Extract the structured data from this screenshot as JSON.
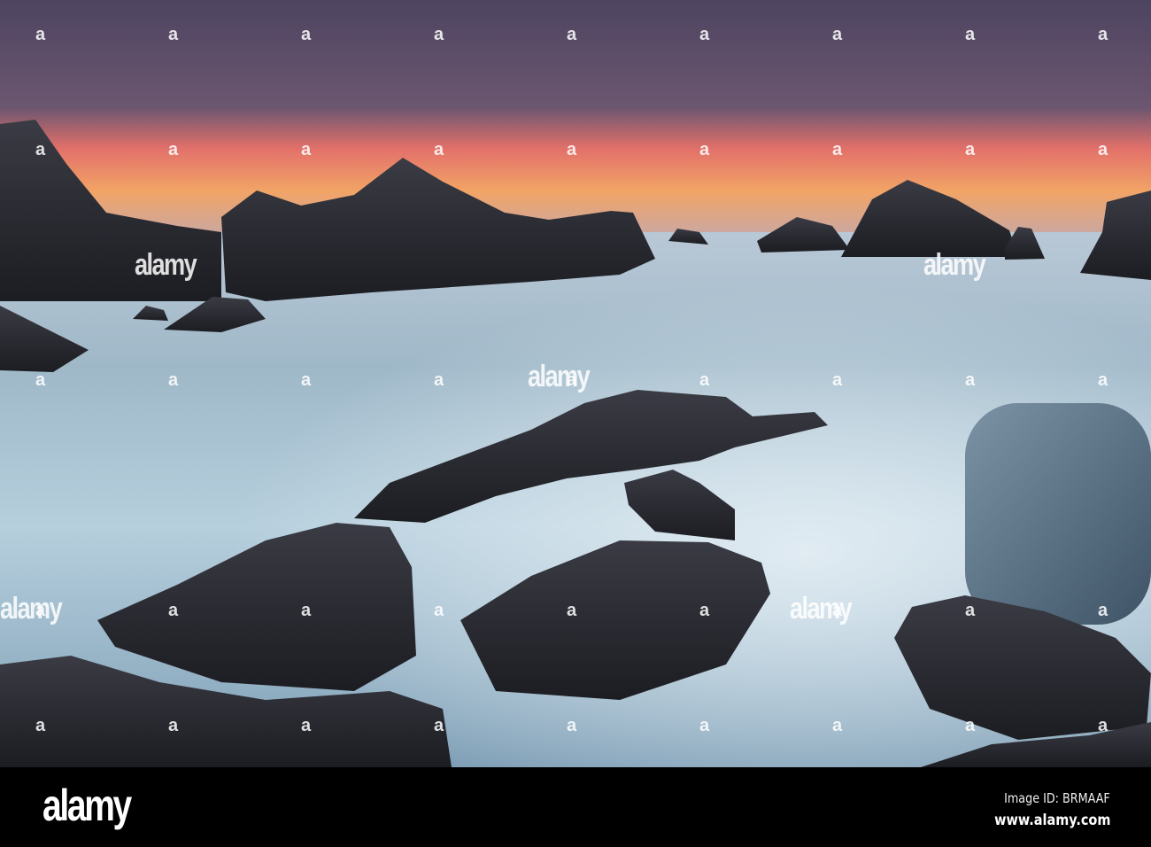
{
  "photo": {
    "subject": "coastal-sunset-rocks",
    "colors": {
      "sky_top": "#4f4560",
      "sky_glow": "#f07a5a",
      "sky_horizon": "#f3b067",
      "sea_light": "#c9dbe6",
      "sea_mid": "#8eabbd",
      "sea_dark": "#3f5d74",
      "rock": "#25262c"
    }
  },
  "watermark": {
    "text": "alamy",
    "mark": "a"
  },
  "footer": {
    "logo": "alamy",
    "image_id": "Image ID: BRMAAF",
    "url": "www.alamy.com"
  }
}
